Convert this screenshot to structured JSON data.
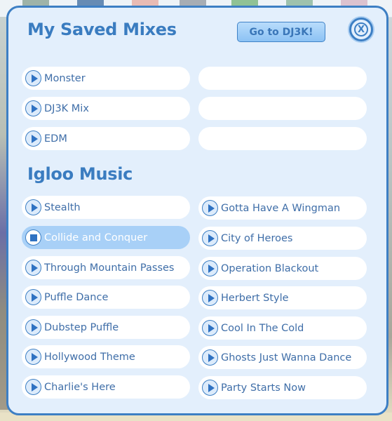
{
  "dialog": {
    "title": "My Saved Mixes",
    "go_button_label": "Go to DJ3K!",
    "close_icon_glyph": "X"
  },
  "saved_mixes": {
    "left": [
      {
        "label": "Monster",
        "icon": "play-icon"
      },
      {
        "label": "DJ3K Mix",
        "icon": "play-icon"
      },
      {
        "label": "EDM",
        "icon": "play-icon"
      }
    ],
    "right": [
      {
        "label": ""
      },
      {
        "label": ""
      },
      {
        "label": ""
      }
    ]
  },
  "igloo_music": {
    "title": "Igloo Music",
    "left": [
      {
        "label": "Stealth",
        "state": "stopped"
      },
      {
        "label": "Collide and Conquer",
        "state": "playing"
      },
      {
        "label": "Through Mountain Passes",
        "state": "stopped"
      },
      {
        "label": "Puffle Dance",
        "state": "stopped"
      },
      {
        "label": "Dubstep Puffle",
        "state": "stopped"
      },
      {
        "label": "Hollywood Theme",
        "state": "stopped"
      },
      {
        "label": "Charlie's Here",
        "state": "stopped"
      }
    ],
    "right": [
      {
        "label": "Gotta Have A Wingman",
        "state": "stopped"
      },
      {
        "label": "City of Heroes",
        "state": "stopped"
      },
      {
        "label": "Operation Blackout",
        "state": "stopped"
      },
      {
        "label": "Herbert Style",
        "state": "stopped"
      },
      {
        "label": "Cool In The Cold",
        "state": "stopped"
      },
      {
        "label": "Ghosts Just Wanna Dance",
        "state": "stopped"
      },
      {
        "label": "Party Starts Now",
        "state": "stopped"
      }
    ]
  },
  "colors": {
    "accent": "#3d7fc4",
    "panel_bg": "#e3effc",
    "active_row": "#a8d0f7",
    "title_text": "#3a7cc0"
  }
}
